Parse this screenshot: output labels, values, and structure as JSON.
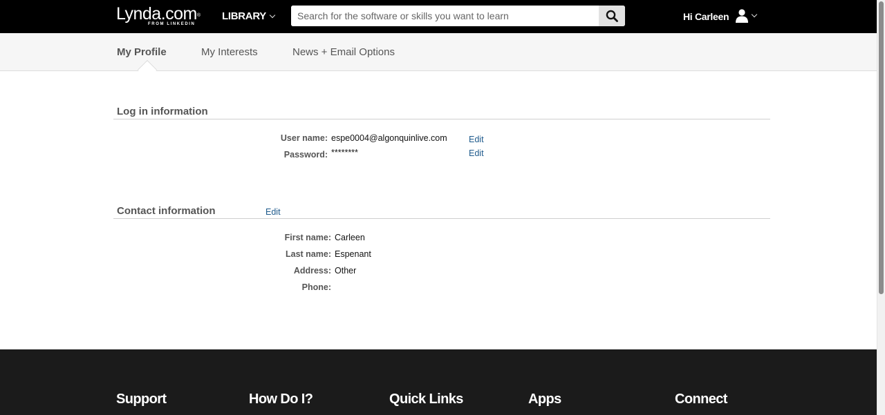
{
  "header": {
    "logo_main": "Lynda.com",
    "logo_reg": "®",
    "logo_sub": "FROM LINKEDIN",
    "library_label": "LIBRARY",
    "search_placeholder": "Search for the software or skills you want to learn",
    "search_value": "",
    "greeting": "Hi Carleen"
  },
  "tabs": [
    {
      "label": "My Profile",
      "active": true
    },
    {
      "label": "My Interests",
      "active": false
    },
    {
      "label": "News + Email Options",
      "active": false
    }
  ],
  "login": {
    "title": "Log in information",
    "username_label": "User name:",
    "username_value": "espe0004@algonquinlive.com",
    "password_label": "Password:",
    "password_value": "********",
    "edit_label": "Edit"
  },
  "contact": {
    "title": "Contact information",
    "edit_label": "Edit",
    "first_name_label": "First name:",
    "first_name_value": "Carleen",
    "last_name_label": "Last name:",
    "last_name_value": "Espenant",
    "address_label": "Address:",
    "address_value": "Other",
    "phone_label": "Phone:",
    "phone_value": ""
  },
  "footer": {
    "columns": [
      "Support",
      "How Do I?",
      "Quick Links",
      "Apps",
      "Connect"
    ]
  },
  "colors": {
    "topbar": "#000000",
    "tabbar": "#f6f6f6",
    "link": "#1e5a8c",
    "footer": "#1b1b1b"
  }
}
